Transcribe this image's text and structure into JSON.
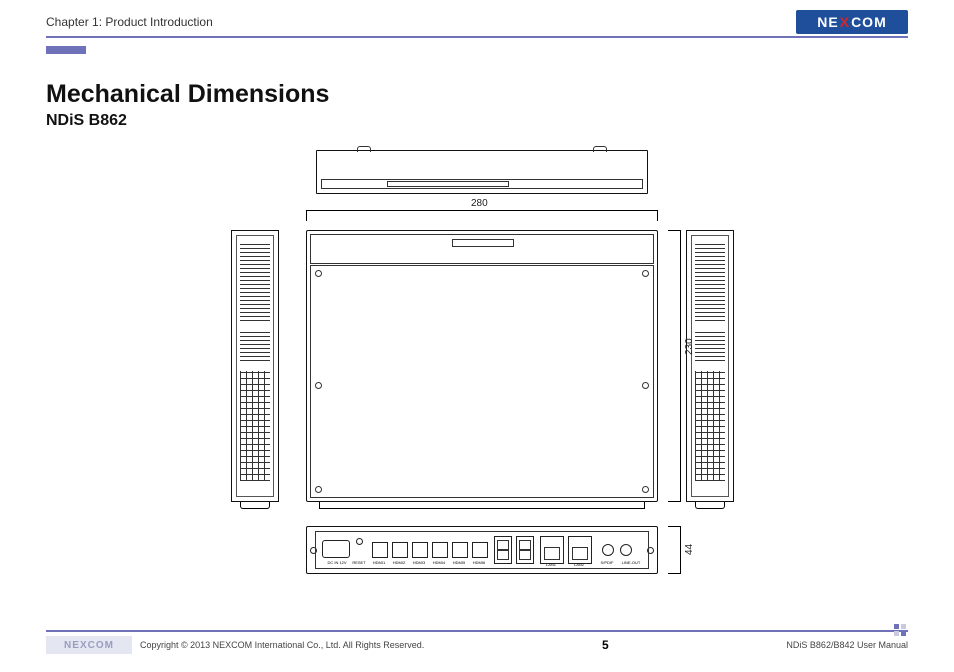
{
  "header": {
    "chapter": "Chapter 1: Product Introduction"
  },
  "brand": {
    "pre": "NE",
    "x": "X",
    "post": "COM"
  },
  "title": "Mechanical Dimensions",
  "subtitle": "NDiS B862",
  "dims": {
    "width": "280",
    "depth": "230",
    "height": "44"
  },
  "rear_ports": {
    "dc": "DC IN 12V",
    "reset": "RESET",
    "hdmi1": "HDMI1",
    "hdmi2": "HDMI2",
    "hdmi3": "HDMI3",
    "hdmi4": "HDMI4",
    "hdmi5": "HDMI5",
    "hdmi6": "HDMI6",
    "lan1": "LAN1",
    "lan2": "LAN2",
    "spdif": "S/PDIF",
    "lineout": "LINE-OUT"
  },
  "footer": {
    "copyright": "Copyright © 2013 NEXCOM International Co., Ltd. All Rights Reserved.",
    "page": "5",
    "doc": "NDiS B862/B842 User Manual"
  }
}
